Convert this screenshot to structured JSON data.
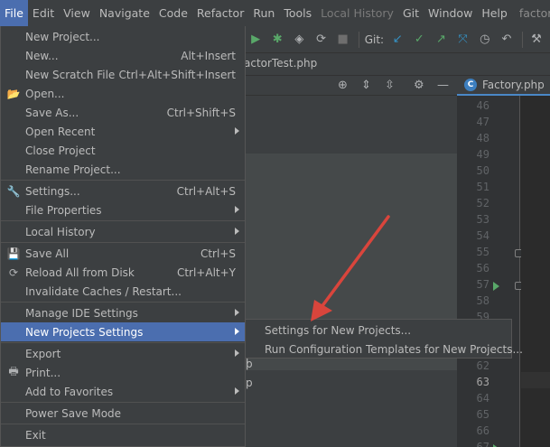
{
  "menubar": {
    "items": [
      "File",
      "Edit",
      "View",
      "Navigate",
      "Code",
      "Refactor",
      "Run",
      "Tools",
      "Local History",
      "Git",
      "Window",
      "Help"
    ],
    "title": "factory - F"
  },
  "toolbar": {
    "git_label": "Git:"
  },
  "editor": {
    "partial_tab_label": "actorTest.php",
    "active_tab_label": "Factory.php",
    "active_tab_badge": "C",
    "line_numbers": [
      "46",
      "47",
      "48",
      "49",
      "50",
      "51",
      "52",
      "53",
      "54",
      "55",
      "56",
      "57",
      "58",
      "59",
      "60",
      "61",
      "62",
      "63",
      "64",
      "65",
      "66",
      "67"
    ],
    "current_line": "63"
  },
  "tree": {
    "fragment_1": "i",
    "fragment_2": "p",
    "fragment_3": "p"
  },
  "file_menu": {
    "items": [
      {
        "label": "New Project...",
        "shortcut": ""
      },
      {
        "label": "New...",
        "shortcut": "Alt+Insert"
      },
      {
        "label": "New Scratch File",
        "shortcut": "Ctrl+Alt+Shift+Insert"
      },
      {
        "label": "Open...",
        "shortcut": ""
      },
      {
        "label": "Save As...",
        "shortcut": "Ctrl+Shift+S"
      },
      {
        "label": "Open Recent",
        "shortcut": ""
      },
      {
        "label": "Close Project",
        "shortcut": ""
      },
      {
        "label": "Rename Project...",
        "shortcut": ""
      },
      {
        "label": "Settings...",
        "shortcut": "Ctrl+Alt+S"
      },
      {
        "label": "File Properties",
        "shortcut": ""
      },
      {
        "label": "Local History",
        "shortcut": ""
      },
      {
        "label": "Save All",
        "shortcut": "Ctrl+S"
      },
      {
        "label": "Reload All from Disk",
        "shortcut": "Ctrl+Alt+Y"
      },
      {
        "label": "Invalidate Caches / Restart...",
        "shortcut": ""
      },
      {
        "label": "Manage IDE Settings",
        "shortcut": ""
      },
      {
        "label": "New Projects Settings",
        "shortcut": ""
      },
      {
        "label": "Export",
        "shortcut": ""
      },
      {
        "label": "Print...",
        "shortcut": ""
      },
      {
        "label": "Add to Favorites",
        "shortcut": ""
      },
      {
        "label": "Power Save Mode",
        "shortcut": ""
      },
      {
        "label": "Exit",
        "shortcut": ""
      }
    ]
  },
  "submenu": {
    "items": [
      "Settings for New Projects...",
      "Run Configuration Templates for New Projects..."
    ]
  },
  "colors": {
    "menu_bg": "#3c3f41",
    "highlight": "#4b6eaf",
    "annotation_arrow": "#d9453c",
    "run_green": "#59a869"
  }
}
